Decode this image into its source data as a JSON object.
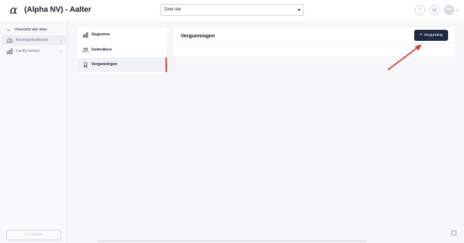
{
  "header": {
    "logo": "α",
    "title": "(Alpha NV) - Aalter",
    "site_select_value": "Zoek site",
    "help_icon": "question-icon",
    "settings_icon": "gear-icon",
    "avatar_initials": "RH"
  },
  "sidebar": {
    "back_label": "Overzicht alle sites",
    "items": [
      {
        "label": "Keuringsdashboard",
        "icon": "dashboard-icon"
      },
      {
        "label": "Facility beheer",
        "icon": "bar-chart-icon"
      }
    ],
    "collapse_label": "Collapse"
  },
  "subnav": {
    "items": [
      {
        "label": "Gegevens",
        "icon": "bar-chart-icon"
      },
      {
        "label": "Gebruikers",
        "icon": "users-icon"
      },
      {
        "label": "Vergunningen",
        "icon": "award-icon",
        "active": true
      }
    ]
  },
  "main": {
    "title": "Vergunningen",
    "add_button_label": "Vergunning"
  },
  "colors": {
    "accent_dark": "#1d2a3f",
    "active_marker": "#e0342a",
    "annotation_arrow": "#e0342a"
  }
}
